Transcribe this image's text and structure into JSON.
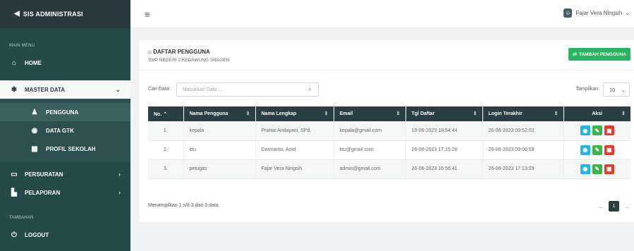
{
  "brand": {
    "title": "SIS ADMINISTRASI"
  },
  "sidebar": {
    "main_menu_label": "MAIN MENU",
    "home": "HOME",
    "master_data": "MASTER DATA",
    "sub_items": [
      "PENGGUNA",
      "DATA GTK",
      "PROFIL SEKOLAH"
    ],
    "persuratan": "PERSURATAN",
    "pelaporan": "PELAPORAN",
    "tambahan_label": "TAMBAHAN",
    "logout": "LOGOUT"
  },
  "topbar": {
    "user_name": "Fajar Vera Ningsih"
  },
  "card": {
    "title": "DAFTAR PENGGUNA",
    "subtitle": "SMP NEGERI 2 KEDAWUNG SRAGEN",
    "add_button": "TAMBAH PENGGUNA"
  },
  "filter": {
    "search_label": "Cari Data:",
    "search_placeholder": "Masukkan Data ...",
    "show_label": "Tampilkan:",
    "show_value": "10"
  },
  "table": {
    "columns": [
      "No.",
      "Nama Pengguna",
      "Nama Lengkap",
      "Email",
      "Tgl Daftar",
      "Login Terakhir",
      "Aksi"
    ],
    "rows": [
      {
        "no": "1.",
        "username": "kepala",
        "fullname": "Pratiwi Andayani, SPd.",
        "email": "kepala@gmail.com",
        "registered": "19-06-2023 18:54:44",
        "last_login": "26-06-2023 09:52:02"
      },
      {
        "no": "2.",
        "username": "ktu",
        "fullname": "Darmanto, Amd",
        "email": "ktu@gmail.com",
        "registered": "26-06-2023 17:15:20",
        "last_login": "26-06-2023 09:00:59"
      },
      {
        "no": "3.",
        "username": "petugas",
        "fullname": "Fajar Vera Ningsih",
        "email": "admin@gmail.com",
        "registered": "26-06-2023 16:56:41",
        "last_login": "26-06-2023 17:13:29"
      }
    ]
  },
  "footer": {
    "info": "Menampilkan 1 s/d 3 dari 3 data",
    "current_page": "1"
  },
  "colors": {
    "sidebar": "#244a49",
    "header": "#2a3f42",
    "add_button": "#28b463",
    "view": "#1fb6e3",
    "edit": "#3cb44a",
    "delete": "#e8382b"
  }
}
